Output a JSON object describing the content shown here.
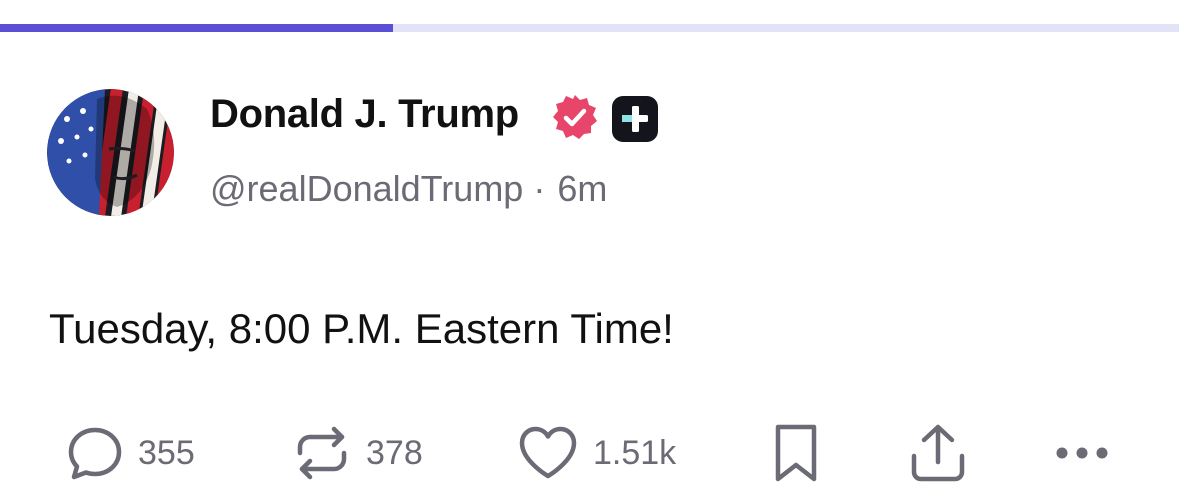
{
  "progress": {
    "fraction": 0.333,
    "fill_color": "#5b4fd6",
    "track_color": "#e3e3f7"
  },
  "author": {
    "display_name": "Donald J. Trump",
    "handle": "@realDonaldTrump",
    "separator": "·",
    "time_ago": "6m",
    "avatar_icon": "flag-portrait-avatar",
    "verified_icon": "verified-badge-icon",
    "verified_color": "#e8456a",
    "plus_icon": "plus-badge-icon"
  },
  "post": {
    "text": "Tuesday, 8:00 P.M. Eastern Time!"
  },
  "actions": {
    "replies": {
      "icon": "reply-icon",
      "count": "355"
    },
    "reposts": {
      "icon": "repost-icon",
      "count": "378"
    },
    "likes": {
      "icon": "heart-icon",
      "count": "1.51k"
    },
    "bookmark": {
      "icon": "bookmark-icon"
    },
    "share": {
      "icon": "share-icon"
    },
    "more": {
      "icon": "more-icon"
    }
  }
}
